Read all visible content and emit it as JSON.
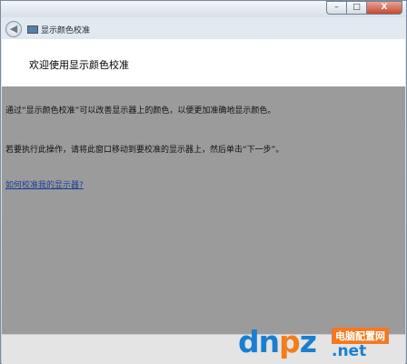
{
  "window": {
    "title": "显示颜色校准",
    "controls": {
      "minimize": "–",
      "maximize": "□",
      "close": "X"
    }
  },
  "nav": {
    "back_icon": "back-arrow-icon",
    "back_glyph": "◀"
  },
  "header": {
    "title": "欢迎使用显示颜色校准"
  },
  "body": {
    "paragraph1": "通过“显示颜色校准”可以改善显示器上的颜色，以便更加准确地显示颜色。",
    "paragraph2": "若要执行此操作，请将此窗口移动到要校准的显示器上，然后单击“下一步”。",
    "help_link": "如何校准我的显示器?"
  },
  "watermark": {
    "logo_part1": "dn",
    "logo_part2": "p",
    "logo_part3": "z",
    "badge": "电脑配置网",
    "domain": ".net"
  },
  "colors": {
    "content_bg": "#9b9b9b",
    "header_bg": "#ffffff",
    "link": "#1b3d9a",
    "watermark_blue": "#1a7fd1",
    "watermark_orange": "#f47920"
  }
}
